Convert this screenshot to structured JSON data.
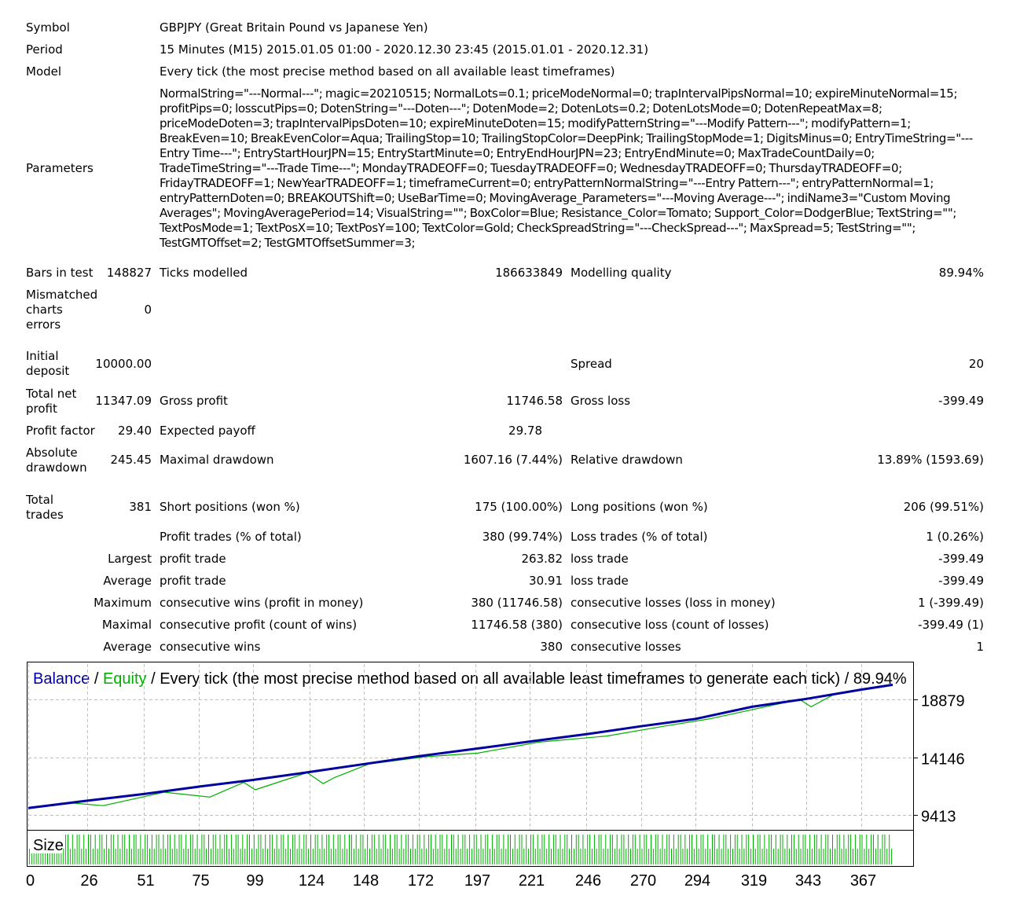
{
  "report": {
    "symbol_label": "Symbol",
    "symbol_value": "GBPJPY (Great Britain Pound vs Japanese Yen)",
    "period_label": "Period",
    "period_value": "15 Minutes (M15) 2015.01.05 01:00 - 2020.12.30 23:45 (2015.01.01 - 2020.12.31)",
    "model_label": "Model",
    "model_value": "Every tick (the most precise method based on all available least timeframes)",
    "parameters_label": "Parameters",
    "parameters_value": "NormalString=\"---Normal---\"; magic=20210515; NormalLots=0.1; priceModeNormal=0; trapIntervalPipsNormal=10; expireMinuteNormal=15; profitPips=0; losscutPips=0; DotenString=\"---Doten---\"; DotenMode=2; DotenLots=0.2; DotenLotsMode=0; DotenRepeatMax=8; priceModeDoten=3; trapIntervalPipsDoten=10; expireMinuteDoten=15; modifyPatternString=\"---Modify Pattern---\"; modifyPattern=1; BreakEven=10; BreakEvenColor=Aqua; TrailingStop=10; TrailingStopColor=DeepPink; TrailingStopMode=1; DigitsMinus=0; EntryTimeString=\"---Entry Time---\"; EntryStartHourJPN=15; EntryStartMinute=0; EntryEndHourJPN=23; EntryEndMinute=0; MaxTradeCountDaily=0; TradeTimeString=\"---Trade Time---\"; MondayTRADEOFF=0; TuesdayTRADEOFF=0; WednesdayTRADEOFF=0; ThursdayTRADEOFF=0; FridayTRADEOFF=1; NewYearTRADEOFF=1; timeframeCurrent=0; entryPatternNormalString=\"---Entry Pattern---\"; entryPatternNormal=1; entryPatternDoten=0; BREAKOUTShift=0; UseBarTime=0; MovingAverage_Parameters=\"---Moving Average---\"; indiName3=\"Custom Moving Averages\"; MovingAveragePeriod=14; VisualString=\"\"; BoxColor=Blue; Resistance_Color=Tomato; Support_Color=DodgerBlue; TextString=\"\"; TextPosMode=1; TextPosX=10; TextPosY=100; TextColor=Gold; CheckSpreadString=\"---CheckSpread---\"; MaxSpread=5; TestString=\"\"; TestGMTOffset=2; TestGMTOffsetSummer=3;",
    "bars_label": "Bars in test",
    "bars_value": "148827",
    "ticks_label": "Ticks modelled",
    "ticks_value": "186633849",
    "quality_label": "Modelling quality",
    "quality_value": "89.94%",
    "mismatched_label": "Mismatched charts errors",
    "mismatched_value": "0",
    "initial_label": "Initial deposit",
    "initial_value": "10000.00",
    "spread_label": "Spread",
    "spread_value": "20",
    "net_label": "Total net profit",
    "net_value": "11347.09",
    "gross_profit_label": "Gross profit",
    "gross_profit_value": "11746.58",
    "gross_loss_label": "Gross loss",
    "gross_loss_value": "-399.49",
    "pf_label": "Profit factor",
    "pf_value": "29.40",
    "ep_label": "Expected payoff",
    "ep_value": "29.78",
    "abs_dd_label": "Absolute drawdown",
    "abs_dd_value": "245.45",
    "max_dd_label": "Maximal drawdown",
    "max_dd_value": "1607.16 (7.44%)",
    "rel_dd_label": "Relative drawdown",
    "rel_dd_value": "13.89% (1593.69)",
    "trades_label": "Total trades",
    "trades_value": "381",
    "short_label": "Short positions (won %)",
    "short_value": "175 (100.00%)",
    "long_label": "Long positions (won %)",
    "long_value": "206 (99.51%)",
    "profit_trades_label": "Profit trades (% of total)",
    "profit_trades_value": "380 (99.74%)",
    "loss_trades_label": "Loss trades (% of total)",
    "loss_trades_value": "1 (0.26%)",
    "largest_label": "Largest",
    "largest_profit_label": "profit trade",
    "largest_profit_value": "263.82",
    "largest_loss_label": "loss trade",
    "largest_loss_value": "-399.49",
    "average_label": "Average",
    "average_profit_label": "profit trade",
    "average_profit_value": "30.91",
    "average_loss_label": "loss trade",
    "average_loss_value": "-399.49",
    "maximum_label": "Maximum",
    "max_cons_wins_label": "consecutive wins (profit in money)",
    "max_cons_wins_value": "380 (11746.58)",
    "max_cons_losses_label": "consecutive losses (loss in money)",
    "max_cons_losses_value": "1 (-399.49)",
    "maximal_label": "Maximal",
    "maximal_profit_label": "consecutive profit (count of wins)",
    "maximal_profit_value": "11746.58 (380)",
    "maximal_loss_label": "consecutive loss (count of losses)",
    "maximal_loss_value": "-399.49 (1)",
    "avg_cons_label": "Average",
    "avg_cons_wins_label": "consecutive wins",
    "avg_cons_wins_value": "380",
    "avg_cons_losses_label": "consecutive losses",
    "avg_cons_losses_value": "1"
  },
  "chart": {
    "legend_balance": "Balance",
    "legend_sep1": " / ",
    "legend_equity": "Equity",
    "legend_rest": " / Every tick (the most precise method based on all available least timeframes to generate each tick) / 89.94%",
    "size_label": "Size",
    "colors": {
      "balance": "#0000a0",
      "equity": "#00b000",
      "size_bars": "#00b000",
      "grid": "#c0c0c0"
    }
  },
  "chart_data": {
    "type": "line",
    "title": "Balance / Equity / Every tick (the most precise method based on all available least timeframes to generate each tick) / 89.94%",
    "x_ticks": [
      0,
      26,
      51,
      75,
      99,
      124,
      148,
      172,
      197,
      221,
      246,
      270,
      294,
      319,
      343,
      367
    ],
    "y_ticks": [
      9413,
      14146,
      18879
    ],
    "xlim": [
      0,
      390
    ],
    "ylim": [
      8600,
      21800
    ],
    "grid": true,
    "series": [
      {
        "name": "Balance",
        "x": [
          0,
          26,
          51,
          75,
          99,
          124,
          148,
          172,
          197,
          221,
          246,
          270,
          294,
          319,
          343,
          367,
          381
        ],
        "y": [
          10000,
          10600,
          11150,
          11750,
          12300,
          12950,
          13600,
          14250,
          14850,
          15450,
          16050,
          16700,
          17300,
          18300,
          18950,
          19700,
          20100
        ]
      },
      {
        "name": "Equity",
        "x": [
          0,
          20,
          33,
          60,
          80,
          95,
          100,
          123,
          130,
          135,
          150,
          175,
          198,
          225,
          255,
          280,
          300,
          340,
          345,
          355,
          370,
          381
        ],
        "y": [
          10000,
          10400,
          10200,
          11300,
          10900,
          12100,
          11500,
          12900,
          12000,
          12500,
          13600,
          14200,
          14500,
          15400,
          15900,
          16700,
          17300,
          18900,
          18300,
          19300,
          19800,
          20100
        ]
      }
    ]
  }
}
